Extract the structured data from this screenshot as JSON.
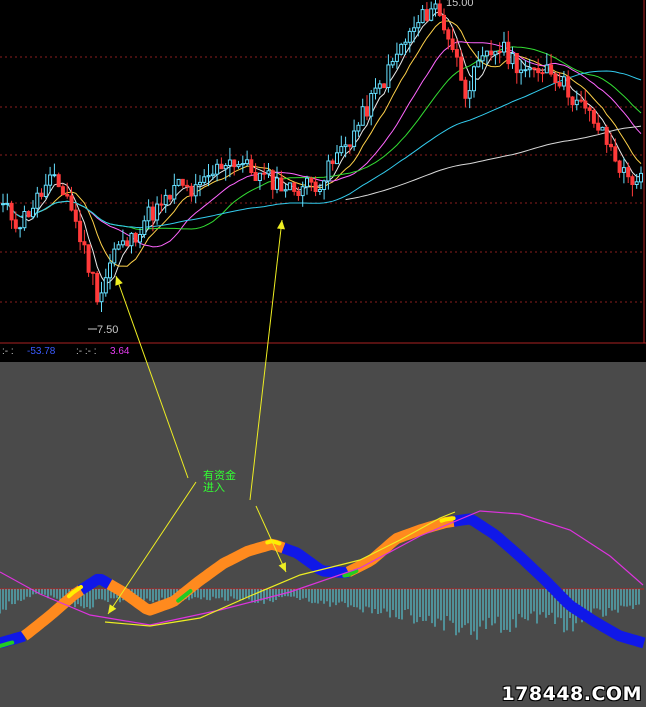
{
  "price_labels": {
    "high": "15.00",
    "low": "7.50"
  },
  "indicator_row": {
    "a_prefix": ":- :",
    "a_value": "-53.78",
    "b_prefix": ":- :- :",
    "b_value": "3.64"
  },
  "annotation": {
    "line1": "有资金",
    "line2": "进入"
  },
  "watermark": "178448.COM",
  "colors": {
    "candle_up": "#66e0ff",
    "candle_down": "#ff3a3a",
    "ma5": "#e8e8e8",
    "ma10": "#ffd24a",
    "ma20": "#ff66ff",
    "ma30": "#33dd33",
    "ma60": "#33ccee",
    "ma120": "#d9d9d9",
    "rising_fund": "#ff8a1e",
    "falling_fund": "#1018e8",
    "fund_entry": "#22cc22",
    "peak_marker": "#ffee00",
    "histogram_up": "#cc2222",
    "histogram_down": "#55d8e8",
    "signal_curve_magenta": "#dd33dd",
    "signal_curve_yellow": "#eeee22",
    "arrow": "#eeee22"
  },
  "chart_data": [
    {
      "type": "candlestick",
      "title": "",
      "price_high": 15.0,
      "price_low": 7.5,
      "moving_averages": [
        "MA5",
        "MA10",
        "MA20",
        "MA30",
        "MA60",
        "MA120"
      ],
      "close_path": [
        10.3,
        9.9,
        10.4,
        10.9,
        10.6,
        9.4,
        8.2,
        9.3,
        9.5,
        10.1,
        10.3,
        10.8,
        10.6,
        11.0,
        11.4,
        11.3,
        11.0,
        10.9,
        10.7,
        10.8,
        10.9,
        11.5,
        12.0,
        12.7,
        13.3,
        14.0,
        14.5,
        15.0,
        14.2,
        13.0,
        13.6,
        14.0,
        13.7,
        13.3,
        13.6,
        13.2,
        12.7,
        12.3,
        11.7,
        11.0,
        10.9
      ]
    },
    {
      "type": "indicator",
      "title": "",
      "series": [
        "fund flow band",
        "histogram",
        "signal curve"
      ],
      "fund_band": [
        -3.0,
        -2.6,
        -1.5,
        -0.3,
        0.6,
        -0.2,
        -1.2,
        -0.7,
        0.4,
        1.4,
        2.1,
        2.5,
        2.0,
        1.0,
        0.9,
        1.6,
        2.8,
        3.3,
        3.7,
        3.9,
        3.0,
        1.8,
        0.5,
        -0.9,
        -1.8,
        -2.6,
        -3.0
      ],
      "fund_entry_markers": 3
    }
  ]
}
